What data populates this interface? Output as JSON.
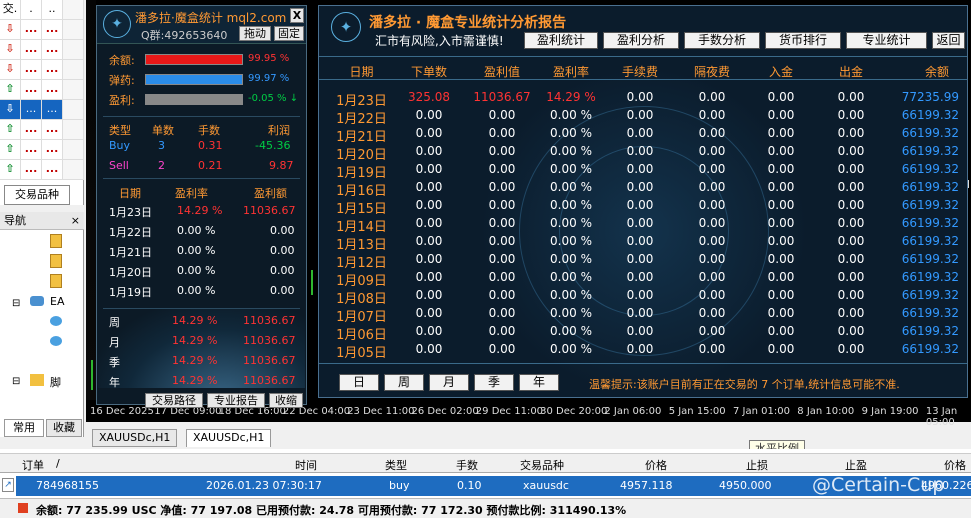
{
  "market_watch": {
    "header": [
      "交.",
      ".",
      ".."
    ],
    "rows": [
      {
        "dir": "dn"
      },
      {
        "dir": "dn"
      },
      {
        "dir": "dn"
      },
      {
        "dir": "up"
      },
      {
        "dir": "dn",
        "sel": true
      },
      {
        "dir": "up"
      },
      {
        "dir": "up"
      },
      {
        "dir": "up"
      }
    ],
    "tab_label": "交易品种",
    "dots": "..."
  },
  "navigator": {
    "title": "导航",
    "close": "×",
    "items": [
      "EA",
      "脚"
    ],
    "tabs": [
      "常用",
      "收藏"
    ]
  },
  "chart": {
    "time_labels": [
      "16 Dec 2025",
      "17 Dec 09:00",
      "18 Dec 16:00",
      "22 Dec 04:00",
      "23 Dec 11:00",
      "26 Dec 02:00",
      "29 Dec 11:00",
      "30 Dec 20:00",
      "2 Jan 06:00",
      "5 Jan 15:00",
      "7 Jan 01:00",
      "8 Jan 10:00",
      "9 Jan 19:00",
      "13 Jan 05:00"
    ],
    "tabs": [
      "XAUUSDc,H1",
      "XAUUSDc,H1"
    ],
    "tooltip": "水平比例"
  },
  "small_panel": {
    "title": "潘多拉·魔盒统计 mql2.com",
    "close": "X",
    "qq": "Q群:492653640",
    "drag_btn": "拖动",
    "fix_btn": "固定",
    "balance_label": "余额:",
    "balance_pct": "99.95 %",
    "ammo_label": "弹药:",
    "ammo_pct": "99.97 %",
    "profit_label": "盈利:",
    "profit_pct": "-0.05 %",
    "profit_arrow": "↓",
    "balance_fill": 0.9995,
    "ammo_fill": 0.9997,
    "trade_head": [
      "类型",
      "单数",
      "手数",
      "利润"
    ],
    "trades": [
      {
        "type": "Buy",
        "count": "3",
        "lots": "0.31",
        "profit": "-45.36"
      },
      {
        "type": "Sell",
        "count": "2",
        "lots": "0.21",
        "profit": "9.87"
      }
    ],
    "day_head": [
      "日期",
      "盈利率",
      "盈利额"
    ],
    "days": [
      {
        "date": "1月23日",
        "rate": "14.29 %",
        "amt": "11036.67"
      },
      {
        "date": "1月22日",
        "rate": "0.00 %",
        "amt": "0.00"
      },
      {
        "date": "1月21日",
        "rate": "0.00 %",
        "amt": "0.00"
      },
      {
        "date": "1月20日",
        "rate": "0.00 %",
        "amt": "0.00"
      },
      {
        "date": "1月19日",
        "rate": "0.00 %",
        "amt": "0.00"
      }
    ],
    "periods": [
      {
        "label": "周",
        "rate": "14.29 %",
        "amt": "11036.67"
      },
      {
        "label": "月",
        "rate": "14.29 %",
        "amt": "11036.67"
      },
      {
        "label": "季",
        "rate": "14.29 %",
        "amt": "11036.67"
      },
      {
        "label": "年",
        "rate": "14.29 %",
        "amt": "11036.67"
      }
    ],
    "footer_btns": [
      "交易路径",
      "专业报告",
      "收缩"
    ]
  },
  "big_panel": {
    "title": "潘多拉 · 魔盒专业统计分析报告",
    "subtitle": "汇市有风险,入市需谨慎!",
    "buttons": [
      "盈利统计",
      "盈利分析",
      "手数分析",
      "货币排行",
      "专业统计",
      "返回"
    ],
    "headers": [
      "日期",
      "下单数",
      "盈利值",
      "盈利率",
      "手续费",
      "隔夜费",
      "入金",
      "出金",
      "余额"
    ],
    "rows": [
      [
        "1月23日",
        "325.08",
        "11036.67",
        "14.29 %",
        "0.00",
        "0.00",
        "0.00",
        "0.00",
        "77235.99"
      ],
      [
        "1月22日",
        "0.00",
        "0.00",
        "0.00 %",
        "0.00",
        "0.00",
        "0.00",
        "0.00",
        "66199.32"
      ],
      [
        "1月21日",
        "0.00",
        "0.00",
        "0.00 %",
        "0.00",
        "0.00",
        "0.00",
        "0.00",
        "66199.32"
      ],
      [
        "1月20日",
        "0.00",
        "0.00",
        "0.00 %",
        "0.00",
        "0.00",
        "0.00",
        "0.00",
        "66199.32"
      ],
      [
        "1月19日",
        "0.00",
        "0.00",
        "0.00 %",
        "0.00",
        "0.00",
        "0.00",
        "0.00",
        "66199.32"
      ],
      [
        "1月16日",
        "0.00",
        "0.00",
        "0.00 %",
        "0.00",
        "0.00",
        "0.00",
        "0.00",
        "66199.32"
      ],
      [
        "1月15日",
        "0.00",
        "0.00",
        "0.00 %",
        "0.00",
        "0.00",
        "0.00",
        "0.00",
        "66199.32"
      ],
      [
        "1月14日",
        "0.00",
        "0.00",
        "0.00 %",
        "0.00",
        "0.00",
        "0.00",
        "0.00",
        "66199.32"
      ],
      [
        "1月13日",
        "0.00",
        "0.00",
        "0.00 %",
        "0.00",
        "0.00",
        "0.00",
        "0.00",
        "66199.32"
      ],
      [
        "1月12日",
        "0.00",
        "0.00",
        "0.00 %",
        "0.00",
        "0.00",
        "0.00",
        "0.00",
        "66199.32"
      ],
      [
        "1月09日",
        "0.00",
        "0.00",
        "0.00 %",
        "0.00",
        "0.00",
        "0.00",
        "0.00",
        "66199.32"
      ],
      [
        "1月08日",
        "0.00",
        "0.00",
        "0.00 %",
        "0.00",
        "0.00",
        "0.00",
        "0.00",
        "66199.32"
      ],
      [
        "1月07日",
        "0.00",
        "0.00",
        "0.00 %",
        "0.00",
        "0.00",
        "0.00",
        "0.00",
        "66199.32"
      ],
      [
        "1月06日",
        "0.00",
        "0.00",
        "0.00 %",
        "0.00",
        "0.00",
        "0.00",
        "0.00",
        "66199.32"
      ],
      [
        "1月05日",
        "0.00",
        "0.00",
        "0.00 %",
        "0.00",
        "0.00",
        "0.00",
        "0.00",
        "66199.32"
      ]
    ],
    "period_btns": [
      "日",
      "周",
      "月",
      "季",
      "年"
    ],
    "note": "温馨提示:该账户目前有正在交易的 7 个订单,统计信息可能不准."
  },
  "trade_table": {
    "headers": [
      "订单",
      "/",
      "时间",
      "类型",
      "手数",
      "交易品种",
      "价格",
      "止损",
      "止盈",
      "价格"
    ],
    "row": {
      "order": "784968155",
      "time": "2026.01.23 07:30:17",
      "type": "buy",
      "lots": "0.10",
      "symbol": "xauusdc",
      "price": "4957.118",
      "sl": "4950.000",
      "tp": "",
      "cur": "4960.226"
    },
    "footer": "余额: 77 235.99 USC  净值: 77 197.08  已用预付款: 24.78  可用预付款: 77 172.30  预付款比例: 311490.13%"
  },
  "watermark": "@Certain-Cup",
  "colors": {
    "accent": "#ff9933",
    "panel_bg": "#0b1c2c",
    "selection": "#1e6cc0"
  }
}
